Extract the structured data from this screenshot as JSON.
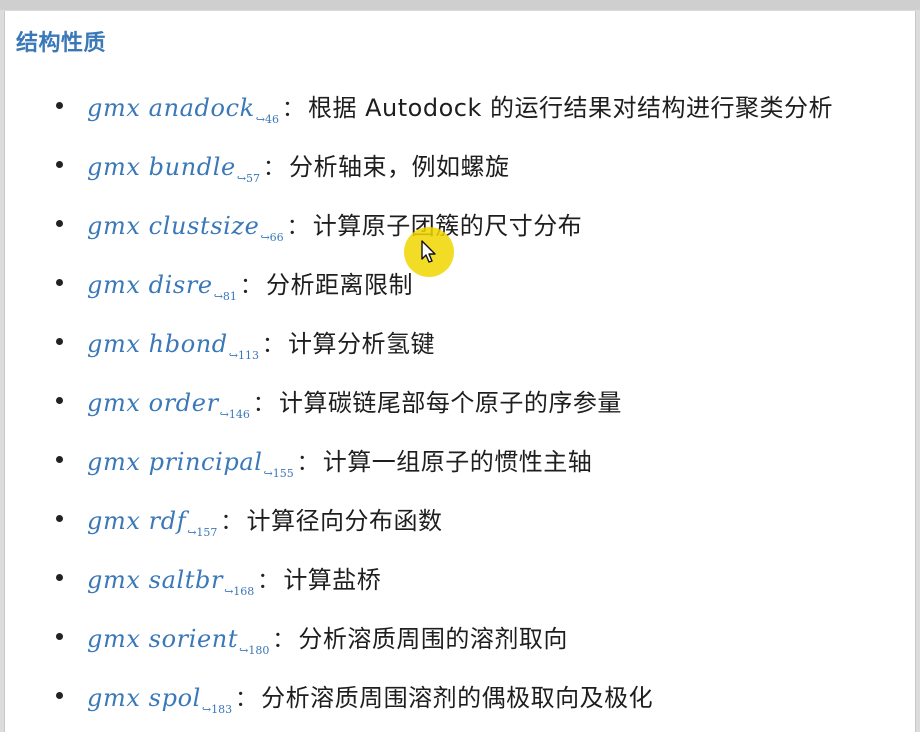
{
  "section": {
    "title": "结构性质"
  },
  "items": [
    {
      "cmd": "gmx anadock",
      "ref": "↪46",
      "colon": "：",
      "desc": "根据 Autodock 的运行结果对结构进行聚类分析"
    },
    {
      "cmd": "gmx bundle",
      "ref": "↪57",
      "colon": "：",
      "desc": "分析轴束，例如螺旋"
    },
    {
      "cmd": "gmx clustsize",
      "ref": "↪66",
      "colon": "：",
      "desc": "计算原子团簇的尺寸分布"
    },
    {
      "cmd": "gmx disre",
      "ref": "↪81",
      "colon": "：",
      "desc": "分析距离限制"
    },
    {
      "cmd": "gmx hbond",
      "ref": "↪113",
      "colon": "：",
      "desc": "计算分析氢键"
    },
    {
      "cmd": "gmx order",
      "ref": "↪146",
      "colon": "：",
      "desc": "计算碳链尾部每个原子的序参量"
    },
    {
      "cmd": "gmx principal",
      "ref": "↪155",
      "colon": "：",
      "desc": "计算一组原子的惯性主轴"
    },
    {
      "cmd": "gmx rdf",
      "ref": "↪157",
      "colon": "：",
      "desc": "计算径向分布函数"
    },
    {
      "cmd": "gmx saltbr",
      "ref": "↪168",
      "colon": "：",
      "desc": "计算盐桥"
    },
    {
      "cmd": "gmx sorient",
      "ref": "↪180",
      "colon": "：",
      "desc": "分析溶质周围的溶剂取向"
    },
    {
      "cmd": "gmx spol",
      "ref": "↪183",
      "colon": "：",
      "desc": "分析溶质周围溶剂的偶极取向及极化"
    }
  ],
  "colors": {
    "link": "#3a78b8",
    "text": "#1e1e1e",
    "cursor_highlight": "#f0d600"
  },
  "icons": {
    "cursor": "move-cursor-icon"
  }
}
